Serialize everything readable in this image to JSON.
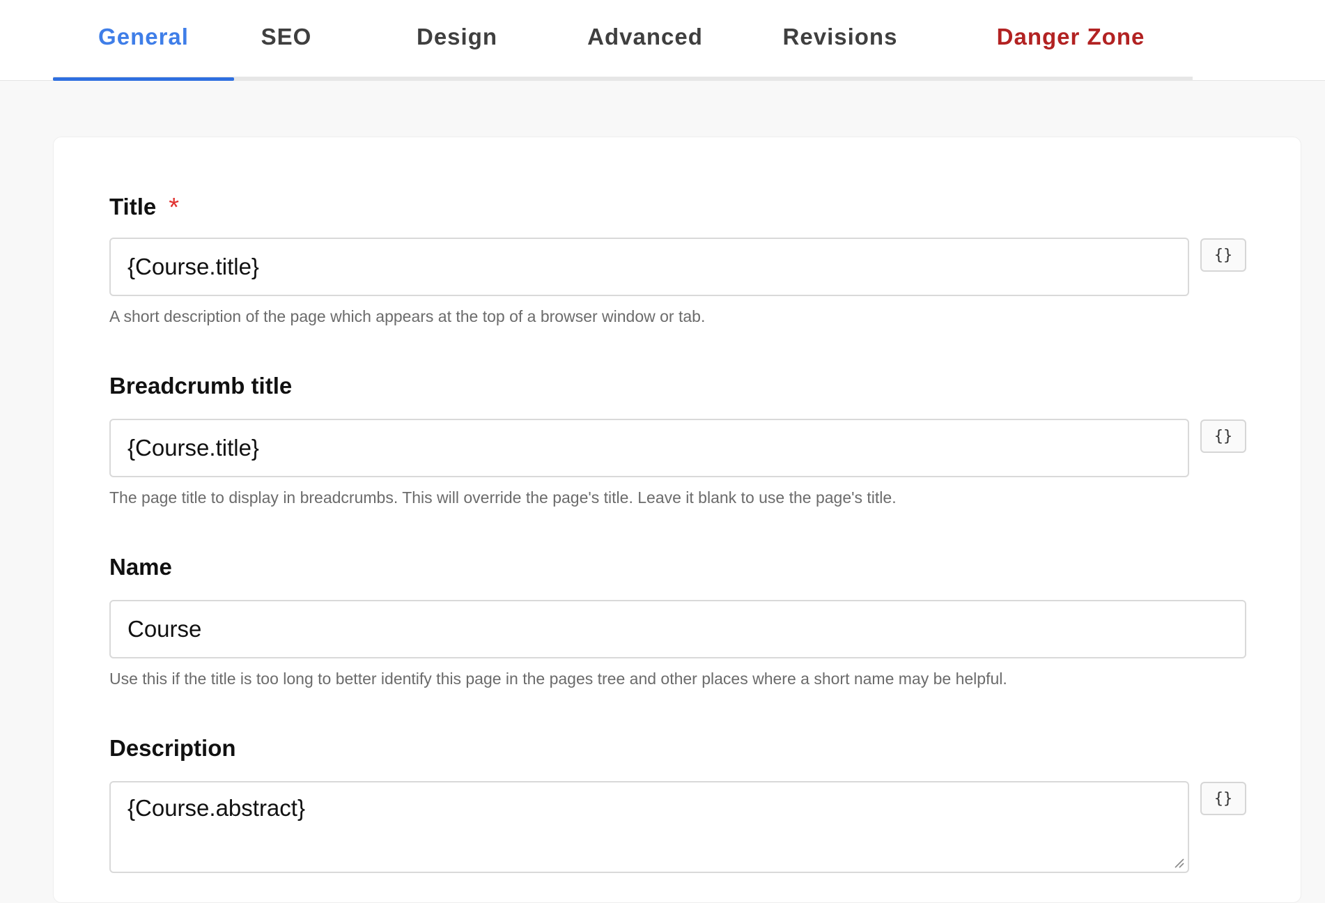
{
  "tabs": [
    {
      "label": "General",
      "state": "active"
    },
    {
      "label": "SEO",
      "state": "normal"
    },
    {
      "label": "Design",
      "state": "normal"
    },
    {
      "label": "Advanced",
      "state": "normal"
    },
    {
      "label": "Revisions",
      "state": "normal"
    },
    {
      "label": "Danger Zone",
      "state": "danger"
    }
  ],
  "colors": {
    "accent": "#2f6fe0",
    "danger": "#b22222",
    "required": "#e0312f"
  },
  "form": {
    "title": {
      "label": "Title",
      "required_mark": "*",
      "value": "{Course.title}",
      "help": "A short description of the page which appears at the top of a browser window or tab.",
      "variable_button": "{}"
    },
    "breadcrumb_title": {
      "label": "Breadcrumb title",
      "value": "{Course.title}",
      "help": "The page title to display in breadcrumbs. This will override the page's title. Leave it blank to use the page's title.",
      "variable_button": "{}"
    },
    "name": {
      "label": "Name",
      "value": "Course",
      "help": "Use this if the title is too long to better identify this page in the pages tree and other places where a short name may be helpful."
    },
    "description": {
      "label": "Description",
      "value": "{Course.abstract}",
      "variable_button": "{}"
    }
  }
}
